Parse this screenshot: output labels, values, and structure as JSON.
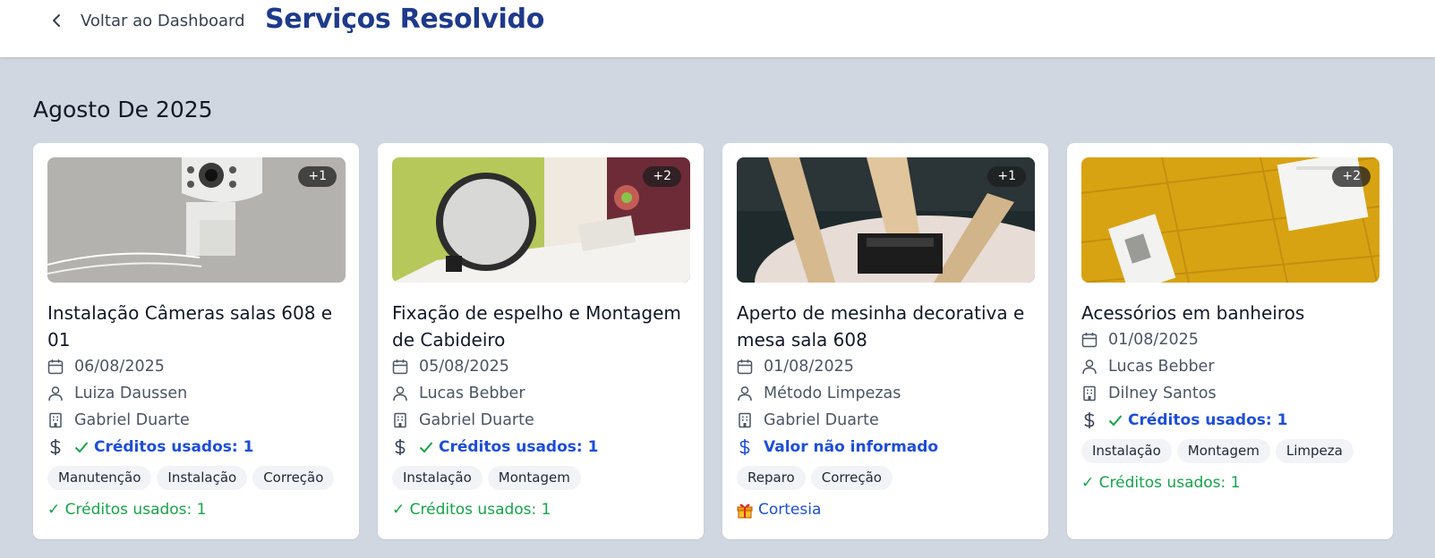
{
  "header": {
    "back_label": "Voltar ao Dashboard",
    "title": "Serviços Resolvido"
  },
  "month_heading": "Agosto De 2025",
  "cards": [
    {
      "photo_count": "+1",
      "title": "Instalação Câmeras salas 608 e 01",
      "date": "06/08/2025",
      "person": "Luiza Daussen",
      "company": "Gabriel Duarte",
      "value": "Créditos usados: 1",
      "tags": [
        "Manutenção",
        "Instalação",
        "Correção"
      ],
      "footer": "✓ Créditos usados: 1"
    },
    {
      "photo_count": "+2",
      "title": "Fixação de espelho e Montagem de Cabideiro",
      "date": "05/08/2025",
      "person": "Lucas Bebber",
      "company": "Gabriel Duarte",
      "value": "Créditos usados: 1",
      "tags": [
        "Instalação",
        "Montagem"
      ],
      "footer": "✓ Créditos usados: 1"
    },
    {
      "photo_count": "+1",
      "title": "Aperto de mesinha decorativa e mesa sala 608",
      "date": "01/08/2025",
      "person": "Método Limpezas",
      "company": "Gabriel Duarte",
      "value": "Valor não informado",
      "tags": [
        "Reparo",
        "Correção"
      ],
      "footer": "Cortesia"
    },
    {
      "photo_count": "+2",
      "title": "Acessórios em banheiros",
      "date": "01/08/2025",
      "person": "Lucas Bebber",
      "company": "Dilney Santos",
      "value": "Créditos usados: 1",
      "tags": [
        "Instalação",
        "Montagem",
        "Limpeza"
      ],
      "footer": "✓ Créditos usados: 1"
    }
  ],
  "colors": {
    "title": "#1e3a8a",
    "link_blue": "#1d4ed8",
    "success_green": "#16a34a",
    "page_bg": "#d1d7e0"
  }
}
